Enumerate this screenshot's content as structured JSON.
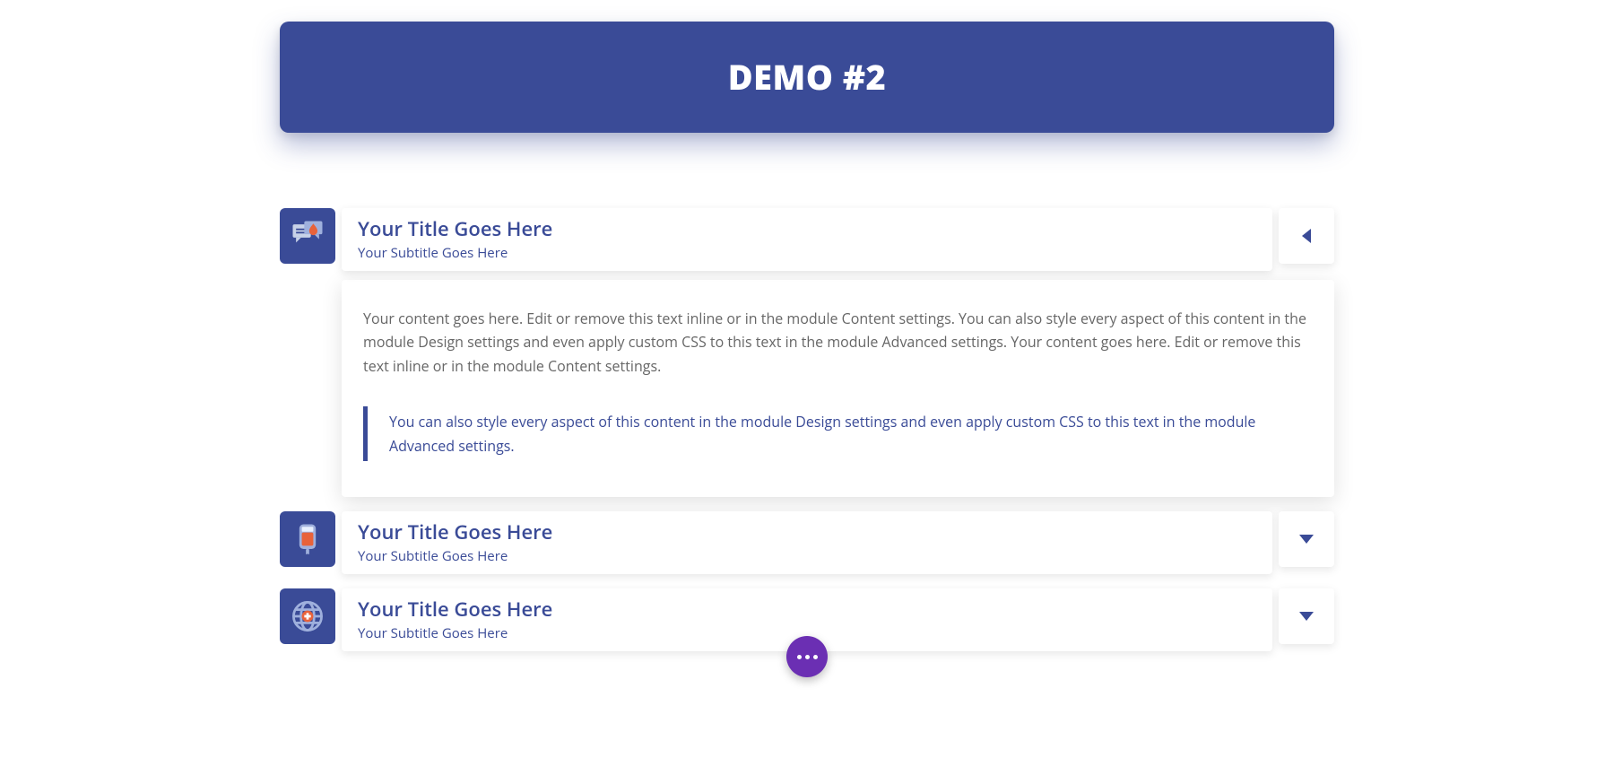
{
  "banner": {
    "title": "DEMO #2"
  },
  "colors": {
    "primary": "#3a4b97",
    "fab": "#6b2fb3"
  },
  "accordion": [
    {
      "icon": "chat-drop-icon",
      "title": "Your Title Goes Here",
      "subtitle": "Your Subtitle Goes Here",
      "expanded": true,
      "body": "Your content goes here. Edit or remove this text inline or in the module Content settings. You can also style every aspect of this content in the module Design settings and even apply custom CSS to this text in the module Advanced settings. Your content goes here. Edit or remove this text inline or in the module Content settings.",
      "quote": "You can also style every aspect of this content in the module Design settings and even apply custom CSS to this text in the module Advanced settings."
    },
    {
      "icon": "iv-bag-icon",
      "title": "Your Title Goes Here",
      "subtitle": "Your Subtitle Goes Here",
      "expanded": false
    },
    {
      "icon": "globe-plus-icon",
      "title": "Your Title Goes Here",
      "subtitle": "Your Subtitle Goes Here",
      "expanded": false
    }
  ]
}
